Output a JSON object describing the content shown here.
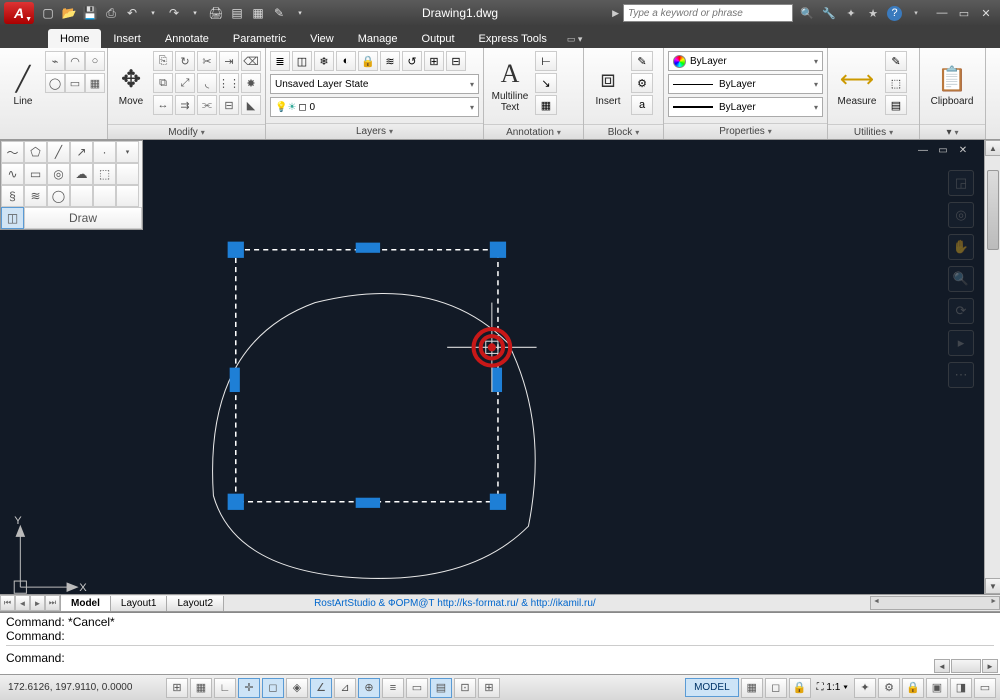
{
  "app": {
    "letter": "A",
    "title": "Drawing1.dwg",
    "search_placeholder": "Type a keyword or phrase"
  },
  "qat_icons": [
    "new",
    "open",
    "save",
    "qsave",
    "undo",
    "redo",
    "print",
    "publish",
    "plot",
    "props"
  ],
  "title_icons": [
    "binoculars",
    "key",
    "lock",
    "star",
    "help"
  ],
  "ribbon": {
    "tabs": [
      "Home",
      "Insert",
      "Annotate",
      "Parametric",
      "View",
      "Manage",
      "Output",
      "Express Tools"
    ],
    "active": 0,
    "draw": {
      "label": "Line",
      "title": "Draw"
    },
    "modify": {
      "label": "Move",
      "title": "Modify"
    },
    "layers": {
      "state": "Unsaved Layer State",
      "current": "0",
      "title": "Layers"
    },
    "annotation": {
      "label": "Multiline\nText",
      "title": "Annotation"
    },
    "block": {
      "label": "Insert",
      "title": "Block"
    },
    "properties": {
      "bylayer": "ByLayer",
      "title": "Properties"
    },
    "utilities": {
      "label": "Measure",
      "title": "Utilities"
    },
    "clipboard": {
      "label": "Clipboard"
    }
  },
  "draw_palette": {
    "title": "Draw"
  },
  "layout": {
    "tabs": [
      "Model",
      "Layout1",
      "Layout2"
    ],
    "active": 0,
    "credit": "RostArtStudio & ФОРМ@Т http://ks-format.ru/ & http://ikamil.ru/"
  },
  "cmd": {
    "l1": "Command: *Cancel*",
    "l2": "Command:",
    "l3": "Command:"
  },
  "status": {
    "coords": "172.6126, 197.9110, 0.0000",
    "model": "MODEL",
    "scale": "1:1"
  },
  "ucs": {
    "x": "X",
    "y": "Y"
  }
}
